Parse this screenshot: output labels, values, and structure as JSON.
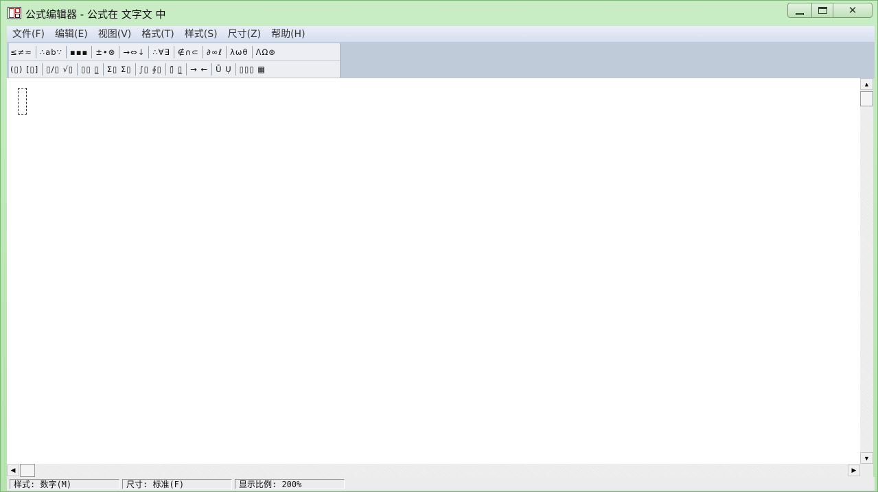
{
  "window": {
    "title": "公式编辑器 - 公式在 文字文 中",
    "controls": {
      "minimize": "—",
      "maximize": "□",
      "close": "✕"
    }
  },
  "menu": {
    "items": [
      "文件(F)",
      "编辑(E)",
      "视图(V)",
      "格式(T)",
      "样式(S)",
      "尺寸(Z)",
      "帮助(H)"
    ]
  },
  "toolbar": {
    "row1": [
      "≤≠≈",
      "∴ab∵",
      "▪▪▪",
      "±•⊗",
      "→⇔↓",
      "∴∀∃",
      "∉∩⊂",
      "∂∞ℓ",
      "λωθ",
      "ΛΩ⊛"
    ],
    "row2": [
      "(▯) [▯]",
      "▯/▯ √▯",
      "▯▯ ▯̲",
      "Σ▯ Σ▯",
      "∫▯ ∮▯",
      "▯̄ ▯̲",
      "→ ←",
      "Ū Ụ",
      "▯▯▯ ▦"
    ]
  },
  "status": {
    "style": "样式: 数字(M)",
    "size": "尺寸: 标准(F)",
    "zoom": "显示比例: 200%"
  },
  "scroll": {
    "up": "▲",
    "down": "▼",
    "left": "◀",
    "right": "▶"
  }
}
